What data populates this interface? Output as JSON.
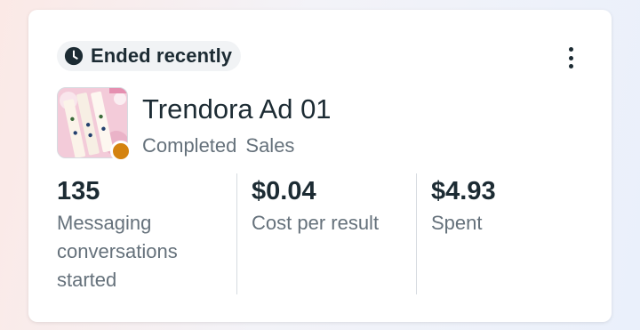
{
  "card": {
    "status_label": "Ended recently",
    "status_icon": "clock-icon",
    "more_icon": "more-vertical-icon",
    "ad_name": "Trendora Ad 01",
    "delivery_status": "Completed",
    "objective": "Sales",
    "status_dot_color": "#d4830f"
  },
  "metrics": [
    {
      "value": "135",
      "label": "Messaging conversations started"
    },
    {
      "value": "$0.04",
      "label": "Cost per result"
    },
    {
      "value": "$4.93",
      "label": "Spent"
    }
  ]
}
